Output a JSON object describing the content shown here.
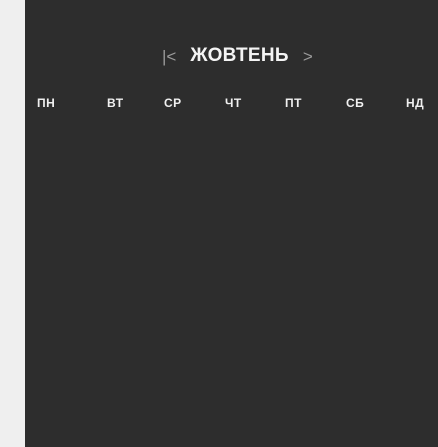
{
  "calendar": {
    "month_title": "ЖОВТЕНЬ",
    "prev_arrow": "|<",
    "next_arrow": ">",
    "weekdays": [
      "ПН",
      "ВТ",
      "СР",
      "ЧТ",
      "ПТ",
      "СБ",
      "НД"
    ]
  },
  "colors": {
    "page_background": "#efefef",
    "calendar_background": "#2d2d2d",
    "text": "#ffffff",
    "arrow": "#9a9a9a"
  },
  "icons": {
    "prev": "chevron-left-icon",
    "next": "chevron-right-icon"
  }
}
